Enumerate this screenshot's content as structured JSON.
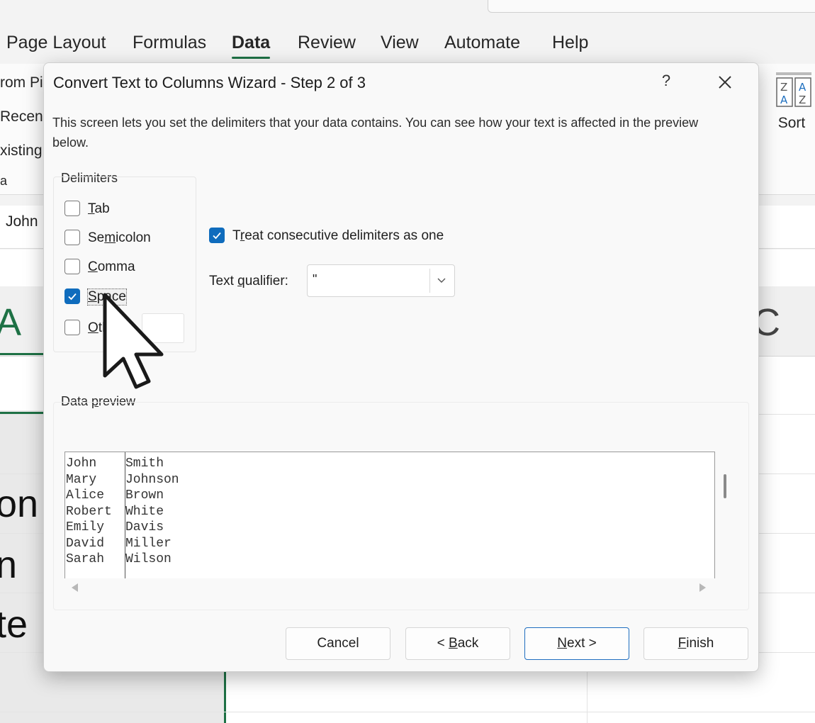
{
  "ribbon": {
    "tabs": [
      "Page Layout",
      "Formulas",
      "Data",
      "Review",
      "View",
      "Automate",
      "Help"
    ],
    "active_tab": "Data",
    "left_items": [
      "rom Pi",
      "Recent",
      "xisting",
      "a"
    ],
    "sort_label": "Sort",
    "sort_icon": "sort-az-icon"
  },
  "formula_bar": {
    "value": "John"
  },
  "sheet": {
    "col_a_header": "A",
    "col_c_header": "C",
    "cells": [
      "on",
      "n",
      "te"
    ]
  },
  "dialog": {
    "title": "Convert Text to Columns Wizard - Step 2 of 3",
    "help": "?",
    "description": "This screen lets you set the delimiters that your data contains. You can see how your text is affected in the preview below.",
    "delimiters_label": "Delimiters",
    "delimiters": [
      {
        "pre": "",
        "key": "T",
        "post": "ab",
        "checked": false
      },
      {
        "pre": "Se",
        "key": "m",
        "post": "icolon",
        "checked": false
      },
      {
        "pre": "",
        "key": "C",
        "post": "omma",
        "checked": false
      },
      {
        "pre": "",
        "key": "S",
        "post": "pace",
        "checked": true
      },
      {
        "pre": "",
        "key": "O",
        "post": "ther:",
        "checked": false
      }
    ],
    "treat_consecutive": {
      "pre": "T",
      "key": "r",
      "post": "eat consecutive delimiters as one",
      "checked": true
    },
    "text_qualifier": {
      "pre": "Text ",
      "key": "q",
      "post": "ualifier:",
      "value": "\""
    },
    "preview_label": {
      "pre": "Data ",
      "key": "p",
      "post": "review"
    },
    "preview_rows": [
      [
        "John",
        "Smith"
      ],
      [
        "Mary",
        "Johnson"
      ],
      [
        "Alice",
        "Brown"
      ],
      [
        "Robert",
        "White"
      ],
      [
        "Emily",
        "Davis"
      ],
      [
        "David",
        "Miller"
      ],
      [
        "Sarah",
        "Wilson"
      ]
    ],
    "buttons": {
      "cancel": {
        "pre": "Cancel",
        "key": "",
        "post": ""
      },
      "back": {
        "pre": "< ",
        "key": "B",
        "post": "ack"
      },
      "next": {
        "pre": "",
        "key": "N",
        "post": "ext >"
      },
      "finish": {
        "pre": "",
        "key": "F",
        "post": "inish"
      }
    },
    "accent_color": "#0f6cbd"
  }
}
